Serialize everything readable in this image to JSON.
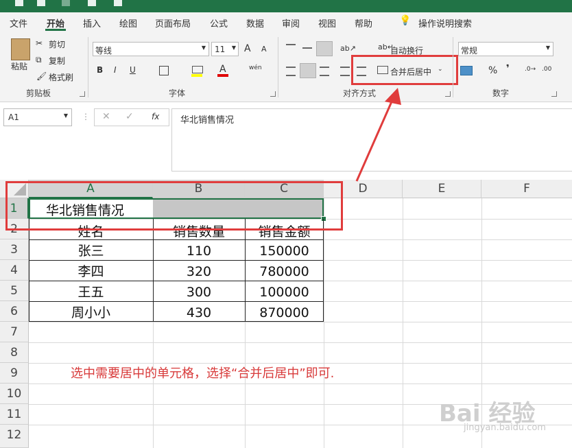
{
  "ribbon": {
    "tabs": [
      "文件",
      "开始",
      "插入",
      "绘图",
      "页面布局",
      "公式",
      "数据",
      "审阅",
      "视图",
      "帮助"
    ],
    "tell_me": "操作说明搜索",
    "clipboard": {
      "paste": "粘贴",
      "cut": "剪切",
      "copy": "复制",
      "format_painter": "格式刷",
      "label": "剪贴板"
    },
    "font": {
      "name": "等线",
      "size": "11",
      "bold": "B",
      "italic": "I",
      "underline": "U",
      "grow": "A",
      "shrink": "A",
      "wen": "wén",
      "label": "字体"
    },
    "alignment": {
      "wrap_text": "自动换行",
      "merge_center": "合并后居中",
      "label": "对齐方式"
    },
    "number": {
      "format": "常规",
      "percent": "%",
      "comma": "❜",
      "label": "数字"
    }
  },
  "formula_bar": {
    "name_box": "A1",
    "fx": "fx",
    "content": "华北销售情况"
  },
  "sheet": {
    "columns": [
      "A",
      "B",
      "C",
      "D",
      "E",
      "F"
    ],
    "rows": [
      "1",
      "2",
      "3",
      "4",
      "5",
      "6",
      "7",
      "8",
      "9",
      "10",
      "11",
      "12"
    ],
    "title": "华北销售情况",
    "headers": [
      "姓名",
      "销售数量",
      "销售金额"
    ],
    "data": [
      [
        "张三",
        "110",
        "150000"
      ],
      [
        "李四",
        "320",
        "780000"
      ],
      [
        "王五",
        "300",
        "100000"
      ],
      [
        "周小小",
        "430",
        "870000"
      ]
    ],
    "annotation": "选中需要居中的单元格，选择“合并后居中”即可."
  },
  "watermark": {
    "brand": "Bai 经验",
    "url": "jingyan.baidu.com"
  },
  "colors": {
    "accent": "#217346",
    "highlight": "#e03c3c",
    "selection": "#c6c6c6"
  }
}
